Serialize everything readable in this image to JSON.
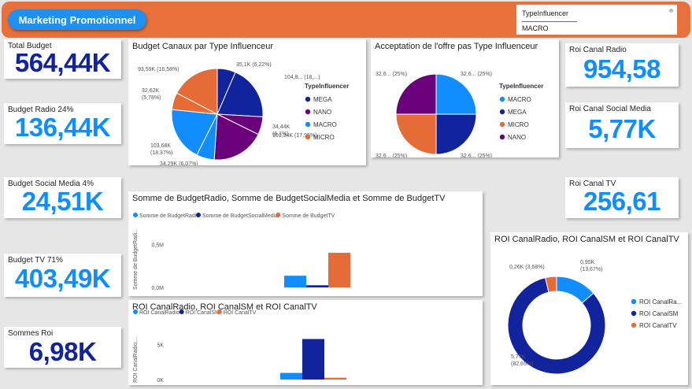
{
  "header": {
    "title": "Marketing Promotionnel"
  },
  "slicer": {
    "label": "TypeInfluencer",
    "value": "MACRO"
  },
  "kpis": {
    "total_budget": {
      "label": "Total Budget",
      "value": "564,44K"
    },
    "budget_radio": {
      "label": "Budget Radio 24%",
      "value": "136,44K"
    },
    "budget_social": {
      "label": "Budget Social Media 4%",
      "value": "24,51K"
    },
    "budget_tv": {
      "label": "Budget TV 71%",
      "value": "403,49K"
    },
    "sommes_roi": {
      "label": "Sommes Roi",
      "value": "6,98K"
    },
    "roi_radio": {
      "label": "Roi Canal Radio",
      "value": "954,58"
    },
    "roi_social": {
      "label": "Roi Canal Social Media",
      "value": "5,77K"
    },
    "roi_tv": {
      "label": "Roi Canal TV",
      "value": "256,61"
    }
  },
  "colors": {
    "mega": "#12239e",
    "nano": "#6b007b",
    "macro": "#118dff",
    "micro": "#e66c37",
    "header": "#e8703a",
    "kpi_dark": "#12239e",
    "kpi_light": "#118dff"
  },
  "chart_data": [
    {
      "type": "pie",
      "title": "Budget Canaux par Type Influenceur",
      "legend_title": "TypeInfluencer",
      "legend_position": "right",
      "categories": [
        "MEGA",
        "NANO",
        "MACRO",
        "MICRO"
      ],
      "slice_labels": [
        "35,1K (6,22%)",
        "104,8... (18,...)",
        "34,44K (6,1%)",
        "101,34K (17,95%)",
        "34,29K (6,07%)",
        "103,68K (18,37%)",
        "32,62K (5,78%)",
        "93,59K (16,58%)"
      ],
      "slices": [
        {
          "category": "MEGA",
          "value": 35.1
        },
        {
          "category": "MEGA",
          "value": 104.8
        },
        {
          "category": "NANO",
          "value": 34.44
        },
        {
          "category": "NANO",
          "value": 101.34
        },
        {
          "category": "MACRO",
          "value": 34.29
        },
        {
          "category": "MACRO",
          "value": 103.68
        },
        {
          "category": "MICRO",
          "value": 32.62
        },
        {
          "category": "MICRO",
          "value": 93.59
        }
      ]
    },
    {
      "type": "pie",
      "title": "Acceptation de l'offre pas Type Influenceur",
      "legend_title": "TypeInfluencer",
      "legend_position": "right",
      "categories": [
        "MACRO",
        "MEGA",
        "MICRO",
        "NANO"
      ],
      "values": [
        25,
        25,
        25,
        25
      ],
      "slice_labels": [
        "32,6... (25%)",
        "32,6... (25%)",
        "32,6... (25%)",
        "32,6... (25%)"
      ]
    },
    {
      "type": "bar",
      "title": "Somme de BudgetRadio, Somme de BudgetSocialMedia et Somme de BudgetTV",
      "ylabel": "Somme de BudgetRadi..",
      "yticks": [
        "0,0M",
        "0,5M"
      ],
      "ylim": [
        0,
        0.55
      ],
      "legend_position": "top-left",
      "series": [
        {
          "name": "Somme de BudgetRadio",
          "value": 0.136
        },
        {
          "name": "Somme de BudgetSocialMedia",
          "value": 0.025
        },
        {
          "name": "Somme de BudgetTV",
          "value": 0.403
        }
      ]
    },
    {
      "type": "bar",
      "title": "ROI CanalRadio, ROI CanalSM et ROI CanalTV",
      "ylabel": "ROI CanalRadio,...",
      "yticks": [
        "0K",
        "5K"
      ],
      "ylim": [
        0,
        6.5
      ],
      "legend_position": "top-left",
      "series": [
        {
          "name": "ROI CanalRadio",
          "value": 0.95
        },
        {
          "name": "ROI CanalSM",
          "value": 5.77
        },
        {
          "name": "ROI CanalTV",
          "value": 0.26
        }
      ]
    },
    {
      "type": "pie",
      "title": "ROI CanalRadio, ROI CanalSM et ROI CanalTV",
      "legend_position": "right",
      "categories": [
        "ROI CanalRa...",
        "ROI CanalSM",
        "ROI CanalTV"
      ],
      "values": [
        0.95,
        5.77,
        0.26
      ],
      "slice_labels": [
        "0,95K (13,67%)",
        "5,77K (82,65%)",
        "0,26K (3,68%)"
      ]
    }
  ]
}
